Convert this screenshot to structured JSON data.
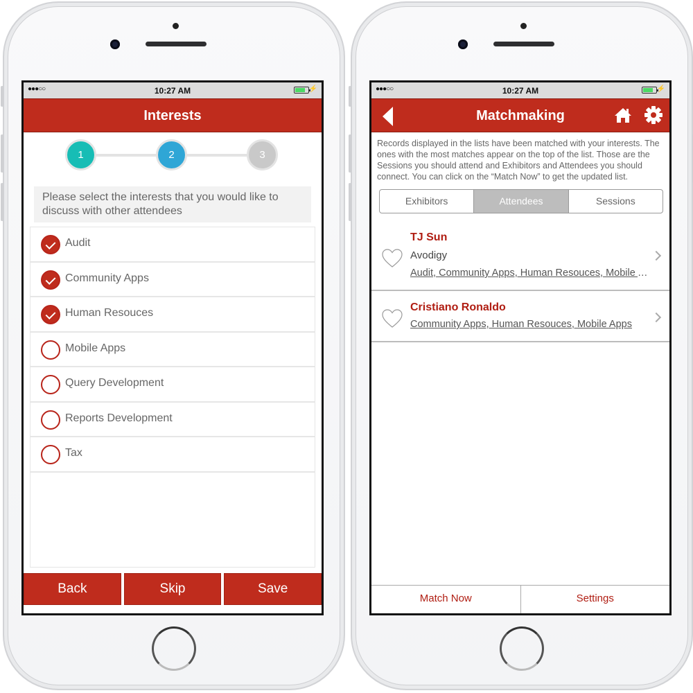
{
  "status_bar": {
    "signal": "●●●○○",
    "time": "10:27 AM",
    "battery_level": 0.7,
    "charging_icon": "⚡"
  },
  "interests_screen": {
    "title": "Interests",
    "steps": [
      "1",
      "2",
      "3"
    ],
    "current_step": 2,
    "prompt": "Please select the interests that you would like to discuss with other attendees",
    "items": [
      {
        "label": "Audit",
        "checked": true
      },
      {
        "label": "Community Apps",
        "checked": true
      },
      {
        "label": "Human Resouces",
        "checked": true
      },
      {
        "label": "Mobile Apps",
        "checked": false
      },
      {
        "label": "Query Development",
        "checked": false
      },
      {
        "label": "Reports Development",
        "checked": false
      },
      {
        "label": "Tax",
        "checked": false
      }
    ],
    "buttons": {
      "back": "Back",
      "skip": "Skip",
      "save": "Save"
    }
  },
  "matchmaking_screen": {
    "title": "Matchmaking",
    "icons": {
      "back": "back-arrow-icon",
      "home": "home-icon",
      "settings": "gear-icon"
    },
    "info": "Records displayed in the lists have been matched with your interests. The ones with the most matches appear on the top of the list. Those are the Sessions you should attend and Exhibitors and Attendees you should connect. You can click on the “Match Now” to get the updated list.",
    "tabs": [
      {
        "label": "Exhibitors",
        "active": false
      },
      {
        "label": "Attendees",
        "active": true
      },
      {
        "label": "Sessions",
        "active": false
      }
    ],
    "records": [
      {
        "name": "TJ Sun",
        "company": "Avodigy",
        "interests": "Audit, Community Apps, Human Resouces, Mobile Apps"
      },
      {
        "name": "Cristiano Ronaldo",
        "company": "",
        "interests": "Community Apps, Human Resouces, Mobile Apps"
      }
    ],
    "bottom_tabs": {
      "match_now": "Match Now",
      "settings": "Settings"
    }
  },
  "colors": {
    "brand_red": "#bf2c1d",
    "step1": "#17bdb5",
    "step2": "#2fa6d6",
    "step3": "#c9c9c9",
    "name_red": "#b01d12"
  }
}
